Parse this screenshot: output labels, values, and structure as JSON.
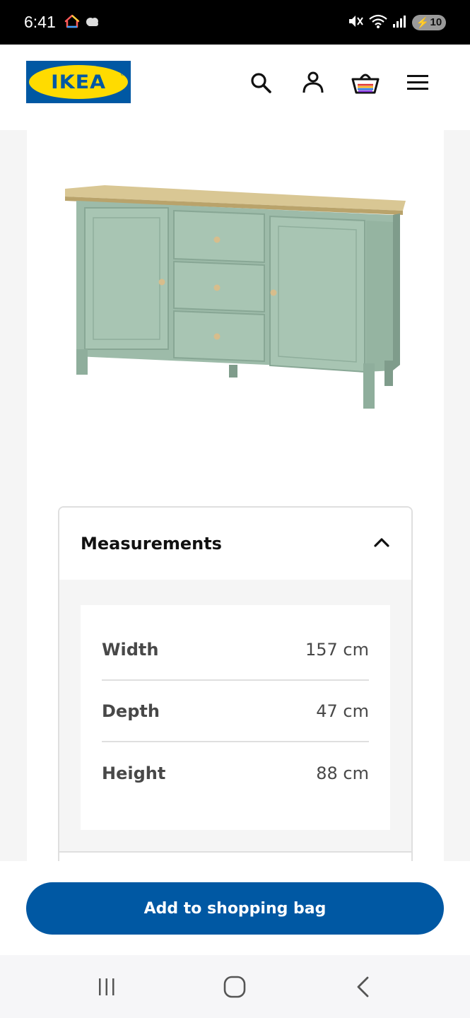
{
  "status_bar": {
    "time": "6:41",
    "battery": "10",
    "icons": [
      "home-icon",
      "cloud-icon",
      "mute-icon",
      "wifi-icon",
      "signal-icon",
      "battery-icon"
    ]
  },
  "header": {
    "logo_text": "IKEA",
    "icons": [
      "search-icon",
      "account-icon",
      "shopping-bag-icon",
      "menu-icon"
    ]
  },
  "product": {
    "image": "sideboard-image"
  },
  "measurements": {
    "title": "Measurements",
    "rows": [
      {
        "label": "Width",
        "value": "157 cm"
      },
      {
        "label": "Depth",
        "value": "47 cm"
      },
      {
        "label": "Height",
        "value": "88 cm"
      }
    ]
  },
  "cta": {
    "label": "Add to shopping bag"
  },
  "nav": {
    "icons": [
      "recent-apps-icon",
      "home-button-icon",
      "back-icon"
    ]
  },
  "colors": {
    "brand_blue": "#0058a3",
    "brand_yellow": "#ffdb00"
  }
}
